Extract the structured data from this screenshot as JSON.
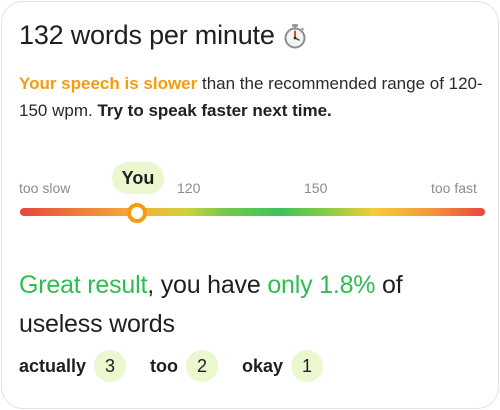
{
  "speed": {
    "headline": "132 words per minute",
    "icon": "stopwatch-icon"
  },
  "pace": {
    "slow_phrase": "Your speech is slower",
    "range_text": " than the recommended range of 120-150 wpm. ",
    "advice": "Try to speak faster next time."
  },
  "scale": {
    "too_slow": "too slow",
    "low_mark": "120",
    "high_mark": "150",
    "too_fast": "too fast",
    "you_label": "You",
    "wpm_value": 132
  },
  "result": {
    "great": "Great result",
    "middle": ", you have ",
    "share": "only 1.8%",
    "tail": " of useless words"
  },
  "useless_words": [
    {
      "word": "actually",
      "count": "3"
    },
    {
      "word": "too",
      "count": "2"
    },
    {
      "word": "okay",
      "count": "1"
    }
  ],
  "colors": {
    "accent_orange": "#f39c12",
    "accent_green": "#2fbd51",
    "pill_bg": "#eaf7cf"
  }
}
